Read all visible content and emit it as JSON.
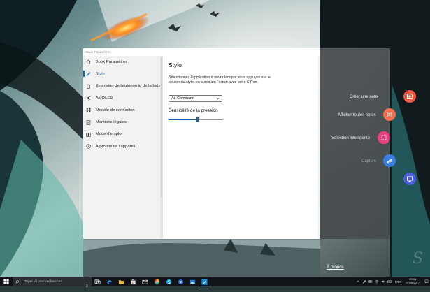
{
  "window": {
    "title": "Book Paramètres"
  },
  "sidebar": {
    "items": [
      {
        "label": "Book Paramètres",
        "icon": "home-icon"
      },
      {
        "label": "Stylo",
        "icon": "pen-icon",
        "active": true
      },
      {
        "label": "Extension de l'autonomie de la batterie",
        "icon": "battery-icon"
      },
      {
        "label": "AMOLED",
        "icon": "brightness-icon"
      },
      {
        "label": "Modèle de connexion",
        "icon": "connection-model-icon"
      },
      {
        "label": "Mentions légales",
        "icon": "legal-icon"
      },
      {
        "label": "Mode d'emploi",
        "icon": "book-icon"
      },
      {
        "label": "À propos de l'appareil",
        "icon": "info-icon"
      }
    ]
  },
  "content": {
    "title": "Stylo",
    "description": "Sélectionnez l'application à ouvrir lorsque vous appuyez sur le bouton du stylet en survolant l'écran avec votre S Pen.",
    "app_select": {
      "value": "Air Command"
    },
    "pressure_heading": "Sensibilité de la pression",
    "pressure_level": 0.52
  },
  "air_command": {
    "items": [
      {
        "label": "Créer une note",
        "icon": "create-note-icon",
        "color": "#f15a40"
      },
      {
        "label": "Afficher toutes notes",
        "icon": "view-notes-icon",
        "color": "#f46b4c"
      },
      {
        "label": "Sélection intelligente",
        "icon": "smart-select-icon",
        "color": "#e8407e"
      },
      {
        "label": "Capture",
        "icon": "capture-write-icon",
        "color": "#3b7fe0",
        "dimmed": true
      },
      {
        "label": "",
        "icon": "screen-icon",
        "color": "#4a5fd8"
      }
    ]
  },
  "footer": {
    "about_link": "À propos",
    "watermark": "S"
  },
  "taskbar": {
    "search_placeholder": "Taper ici pour rechercher",
    "pinned": [
      "task-view-icon",
      "edge-icon",
      "file-explorer-icon",
      "store-icon",
      "mail-icon",
      "chrome-icon",
      "skype-icon",
      "app-icon",
      "photos-icon",
      "pen-app-icon"
    ],
    "tray": {
      "language": "FRA",
      "time": "23:01",
      "date": "07/06/2017"
    }
  },
  "colors": {
    "accent": "#1a64b5",
    "overlay": "#464a4e",
    "taskbar": "#101418"
  }
}
